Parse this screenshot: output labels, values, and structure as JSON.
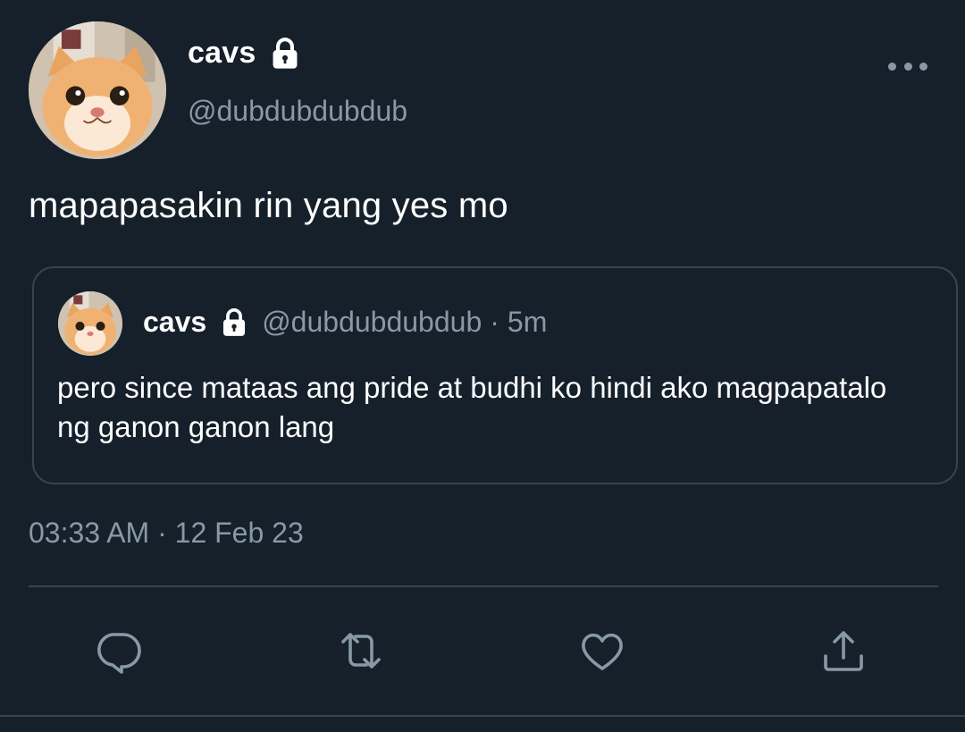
{
  "tweet": {
    "author": {
      "display_name": "cavs",
      "handle": "@dubdubdubdub",
      "protected_icon": "lock-icon",
      "avatar": "cat-avatar"
    },
    "text": "mapapasakin rin yang yes mo",
    "timestamp": "03:33 AM · 12 Feb 23",
    "more_icon": "more-horizontal-icon"
  },
  "quoted_tweet": {
    "display_name": "cavs",
    "handle": "@dubdubdubdub",
    "separator": "·",
    "time": "5m",
    "text": "pero since mataas ang pride at budhi ko hindi ako magpapatalo ng ganon ganon lang"
  },
  "actions": [
    {
      "icon": "reply-icon"
    },
    {
      "icon": "retweet-icon"
    },
    {
      "icon": "like-icon"
    },
    {
      "icon": "share-icon"
    }
  ],
  "colors": {
    "background": "#15202b",
    "secondary_text": "#8899a6",
    "border": "#38444d",
    "primary_text": "#ffffff"
  }
}
